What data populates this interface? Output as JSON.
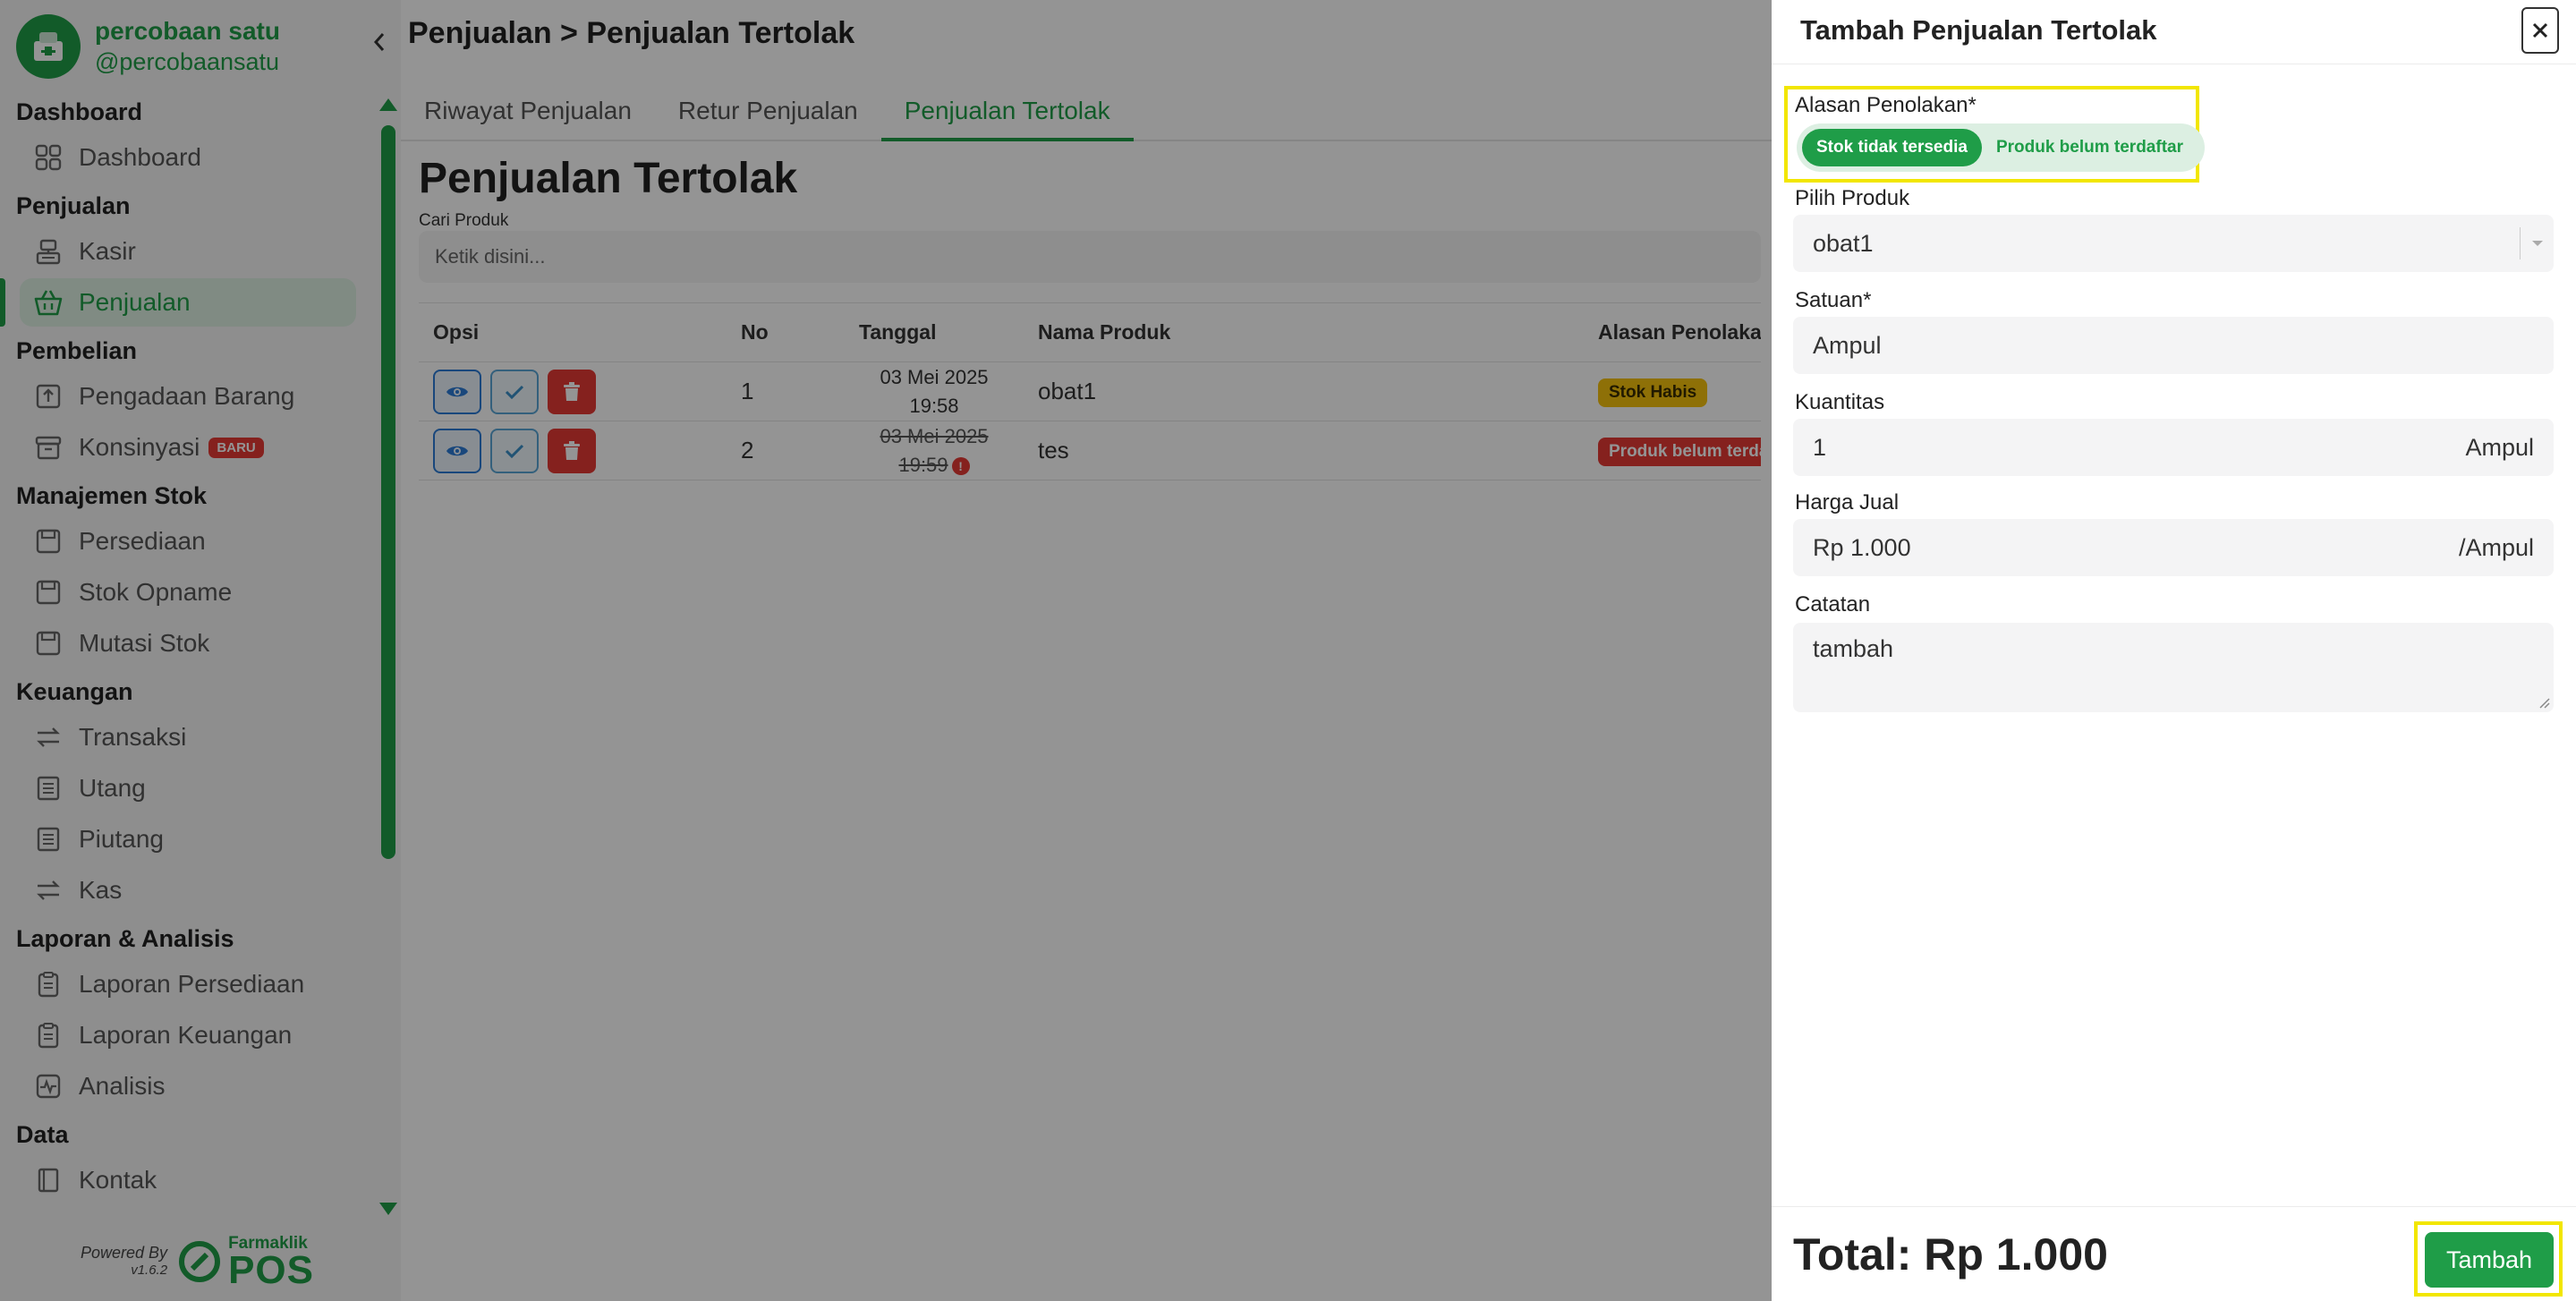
{
  "brand": {
    "name": "percobaan satu",
    "handle": "@percobaansatu"
  },
  "sidebar": {
    "sections": [
      {
        "title": "Dashboard",
        "items": [
          {
            "label": "Dashboard",
            "icon": "grid-icon"
          }
        ]
      },
      {
        "title": "Penjualan",
        "items": [
          {
            "label": "Kasir",
            "icon": "cash-register-icon"
          },
          {
            "label": "Penjualan",
            "icon": "basket-icon",
            "active": true
          }
        ]
      },
      {
        "title": "Pembelian",
        "items": [
          {
            "label": "Pengadaan Barang",
            "icon": "upload-box-icon"
          },
          {
            "label": "Konsinyasi",
            "icon": "archive-icon",
            "badge": "BARU"
          }
        ]
      },
      {
        "title": "Manajemen Stok",
        "items": [
          {
            "label": "Persediaan",
            "icon": "floppy-icon"
          },
          {
            "label": "Stok Opname",
            "icon": "floppy-icon"
          },
          {
            "label": "Mutasi Stok",
            "icon": "floppy-icon"
          }
        ]
      },
      {
        "title": "Keuangan",
        "items": [
          {
            "label": "Transaksi",
            "icon": "transfer-icon"
          },
          {
            "label": "Utang",
            "icon": "ledger-icon"
          },
          {
            "label": "Piutang",
            "icon": "ledger-icon"
          },
          {
            "label": "Kas",
            "icon": "transfer-icon"
          }
        ]
      },
      {
        "title": "Laporan & Analisis",
        "items": [
          {
            "label": "Laporan Persediaan",
            "icon": "clipboard-icon"
          },
          {
            "label": "Laporan Keuangan",
            "icon": "clipboard-icon"
          },
          {
            "label": "Analisis",
            "icon": "pulse-icon"
          }
        ]
      },
      {
        "title": "Data",
        "items": [
          {
            "label": "Kontak",
            "icon": "contact-book-icon"
          }
        ]
      }
    ],
    "powered": {
      "label": "Powered By",
      "version": "v1.6.2",
      "product_brand": "Farmaklik",
      "product_name": "POS"
    }
  },
  "main": {
    "breadcrumb": "Penjualan > Penjualan Tertolak",
    "tabs": [
      {
        "label": "Riwayat Penjualan",
        "active": false
      },
      {
        "label": "Retur Penjualan",
        "active": false
      },
      {
        "label": "Penjualan Tertolak",
        "active": true
      }
    ],
    "title": "Penjualan Tertolak",
    "search": {
      "label": "Cari Produk",
      "placeholder": "Ketik disini..."
    },
    "table": {
      "columns": [
        "Opsi",
        "No",
        "Tanggal",
        "Nama Produk",
        "Alasan Penolakan"
      ],
      "rows": [
        {
          "no": "1",
          "date": "03 Mei 2025",
          "time": "19:58",
          "product": "obat1",
          "reason": "Stok Habis",
          "reason_color": "#f4c20d",
          "strikethrough": false
        },
        {
          "no": "2",
          "date": "03 Mei 2025",
          "time": "19:59",
          "product": "tes",
          "reason": "Produk belum terdaftar",
          "reason_color": "#e53935",
          "strikethrough": true
        }
      ]
    }
  },
  "drawer": {
    "title": "Tambah Penjualan Tertolak",
    "reason": {
      "label": "Alasan Penolakan*",
      "options": [
        "Stok tidak tersedia",
        "Produk belum terdaftar"
      ],
      "selected": "Stok tidak tersedia"
    },
    "product": {
      "label": "Pilih Produk",
      "value": "obat1"
    },
    "unit": {
      "label": "Satuan*",
      "value": "Ampul"
    },
    "quantity": {
      "label": "Kuantitas",
      "value": "1",
      "suffix": "Ampul"
    },
    "price": {
      "label": "Harga Jual",
      "value": "Rp 1.000",
      "suffix": "/Ampul"
    },
    "notes": {
      "label": "Catatan",
      "value": "tambah"
    },
    "total": "Total: Rp 1.000",
    "submit_label": "Tambah"
  },
  "colors": {
    "accent": "#1f9d48",
    "accent_light": "#dcefe2",
    "danger": "#e53935",
    "warning": "#f4c20d",
    "highlight": "#f2e600"
  }
}
